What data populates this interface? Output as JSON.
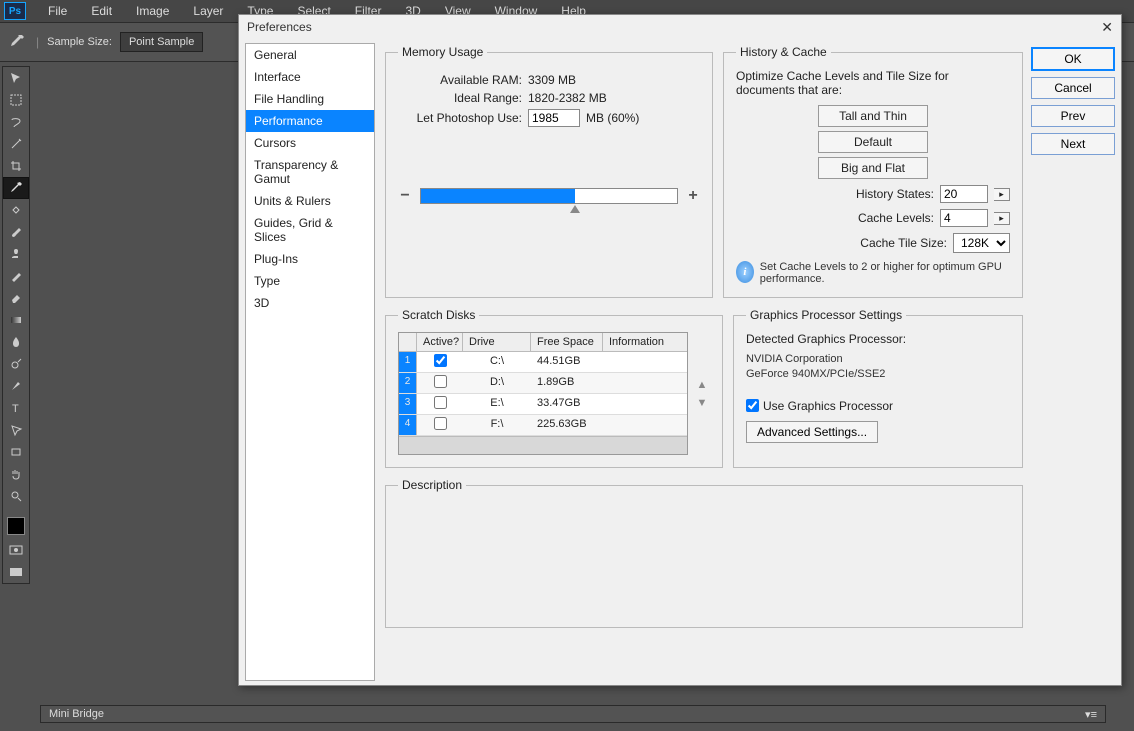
{
  "app": {
    "logo": "Ps"
  },
  "menu": [
    "File",
    "Edit",
    "Image",
    "Layer",
    "Type",
    "Select",
    "Filter",
    "3D",
    "View",
    "Window",
    "Help"
  ],
  "options": {
    "sample_label": "Sample Size:",
    "sample_value": "Point Sample"
  },
  "minibridge": "Mini Bridge",
  "dialog": {
    "title": "Preferences",
    "sidebar": [
      "General",
      "Interface",
      "File Handling",
      "Performance",
      "Cursors",
      "Transparency & Gamut",
      "Units & Rulers",
      "Guides, Grid & Slices",
      "Plug-Ins",
      "Type",
      "3D"
    ],
    "selected_index": 3,
    "buttons": {
      "ok": "OK",
      "cancel": "Cancel",
      "prev": "Prev",
      "next": "Next"
    },
    "memory": {
      "legend": "Memory Usage",
      "available_label": "Available RAM:",
      "available_value": "3309 MB",
      "ideal_label": "Ideal Range:",
      "ideal_value": "1820-2382 MB",
      "let_label": "Let Photoshop Use:",
      "let_value": "1985",
      "let_suffix": "MB (60%)",
      "minus": "−",
      "plus": "+"
    },
    "history": {
      "legend": "History & Cache",
      "intro": "Optimize Cache Levels and Tile Size for documents that are:",
      "btn_tall": "Tall and Thin",
      "btn_default": "Default",
      "btn_big": "Big and Flat",
      "states_label": "History States:",
      "states_value": "20",
      "levels_label": "Cache Levels:",
      "levels_value": "4",
      "tile_label": "Cache Tile Size:",
      "tile_value": "128K",
      "info": "Set Cache Levels to 2 or higher for optimum GPU performance."
    },
    "scratch": {
      "legend": "Scratch Disks",
      "headers": {
        "active": "Active?",
        "drive": "Drive",
        "free": "Free Space",
        "info": "Information"
      },
      "rows": [
        {
          "n": "1",
          "active": true,
          "drive": "C:\\",
          "free": "44.51GB",
          "info": ""
        },
        {
          "n": "2",
          "active": false,
          "drive": "D:\\",
          "free": "1.89GB",
          "info": ""
        },
        {
          "n": "3",
          "active": false,
          "drive": "E:\\",
          "free": "33.47GB",
          "info": ""
        },
        {
          "n": "4",
          "active": false,
          "drive": "F:\\",
          "free": "225.63GB",
          "info": ""
        }
      ]
    },
    "gpu": {
      "legend": "Graphics Processor Settings",
      "detected_label": "Detected Graphics Processor:",
      "vendor": "NVIDIA Corporation",
      "model": "GeForce 940MX/PCIe/SSE2",
      "use_label": "Use Graphics Processor",
      "advanced": "Advanced Settings..."
    },
    "description": {
      "legend": "Description"
    }
  }
}
